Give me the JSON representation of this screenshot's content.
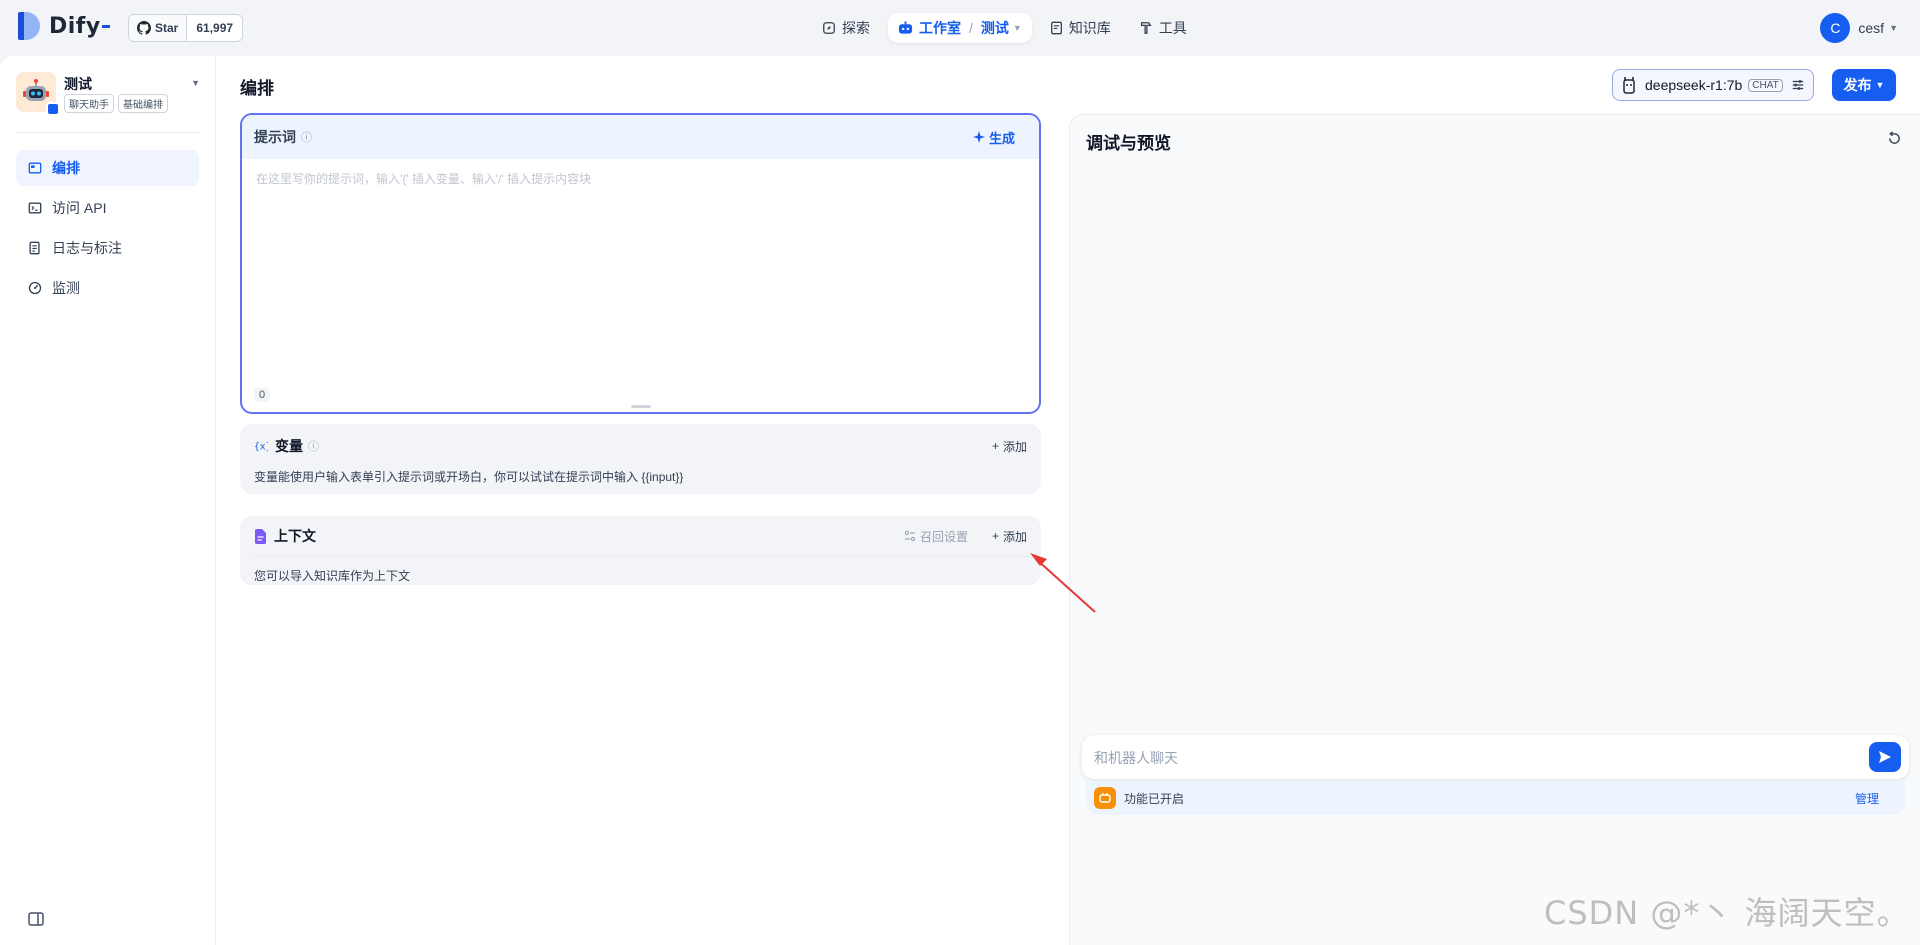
{
  "brand": {
    "name": "Dify"
  },
  "github": {
    "star_label": "Star",
    "count": "61,997"
  },
  "nav": {
    "explore": "探索",
    "studio": "工作室",
    "current_app": "测试",
    "knowledge": "知识库",
    "tools": "工具"
  },
  "user": {
    "initial": "C",
    "name": "cesf"
  },
  "app": {
    "name": "测试",
    "tags": [
      "聊天助手",
      "基础编排"
    ]
  },
  "sidebar": {
    "items": [
      {
        "label": "编排",
        "icon": "layout-icon",
        "active": true
      },
      {
        "label": "访问 API",
        "icon": "terminal-icon",
        "active": false
      },
      {
        "label": "日志与标注",
        "icon": "file-list-icon",
        "active": false
      },
      {
        "label": "监测",
        "icon": "dashboard-icon",
        "active": false
      }
    ]
  },
  "main": {
    "title": "编排",
    "model": {
      "name": "deepseek-r1:7b",
      "mode": "CHAT"
    },
    "publish_label": "发布"
  },
  "prompt": {
    "title": "提示词",
    "generate_label": "生成",
    "placeholder": "在这里写你的提示词，输入'{' 插入变量、输入'/' 插入提示内容块",
    "char_count": "0"
  },
  "variables": {
    "title": "变量",
    "add_label": "添加",
    "description": "变量能使用户输入表单引入提示词或开场白，你可以试试在提示词中输入 {{input}}"
  },
  "context": {
    "title": "上下文",
    "recall_label": "召回设置",
    "add_label": "添加",
    "description": "您可以导入知识库作为上下文"
  },
  "debug": {
    "title": "调试与预览",
    "chat_placeholder": "和机器人聊天",
    "feature_text": "功能已开启",
    "feature_manage": "管理"
  },
  "watermark": "CSDN @*丶 海阔天空。",
  "colors": {
    "primary": "#155eef",
    "annotation_arrow": "#e53935",
    "feature_icon": "#f79009"
  }
}
